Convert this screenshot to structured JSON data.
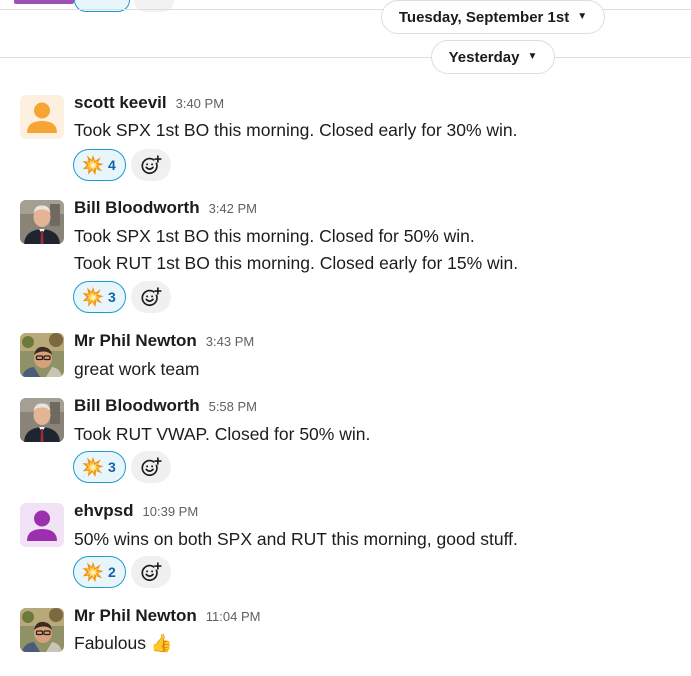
{
  "dividers": {
    "upper_date": "Tuesday, September 1st",
    "lower_date": "Yesterday"
  },
  "messages": [
    {
      "sender": "scott keevil",
      "time": "3:40 PM",
      "lines": [
        "Took SPX 1st BO this morning. Closed early for 30% win."
      ],
      "reaction": {
        "emoji": "collision-emoji",
        "count": "4"
      }
    },
    {
      "sender": "Bill Bloodworth",
      "time": "3:42 PM",
      "lines": [
        "Took SPX 1st BO this morning. Closed for 50% win.",
        "Took RUT 1st BO this morning. Closed early for 15% win."
      ],
      "reaction": {
        "emoji": "collision-emoji",
        "count": "3"
      }
    },
    {
      "sender": "Mr Phil Newton",
      "time": "3:43 PM",
      "lines": [
        "great work team"
      ]
    },
    {
      "sender": "Bill Bloodworth",
      "time": "5:58 PM",
      "lines": [
        "Took RUT VWAP. Closed for 50% win."
      ],
      "reaction": {
        "emoji": "collision-emoji",
        "count": "3"
      }
    },
    {
      "sender": "ehvpsd",
      "time": "10:39 PM",
      "lines": [
        "50% wins on both SPX and RUT this morning, good stuff."
      ],
      "reaction": {
        "emoji": "collision-emoji",
        "count": "2"
      }
    },
    {
      "sender": "Mr Phil Newton",
      "time": "11:04 PM",
      "lines": [
        "Fabulous 👍"
      ]
    }
  ],
  "colors": {
    "reaction_border": "#1d9bd1",
    "reaction_bg": "#e8f5fa",
    "reaction_count": "#1264a3",
    "default_avatar_orange": "#f6a534",
    "default_avatar_purple": "#9b2fae"
  }
}
